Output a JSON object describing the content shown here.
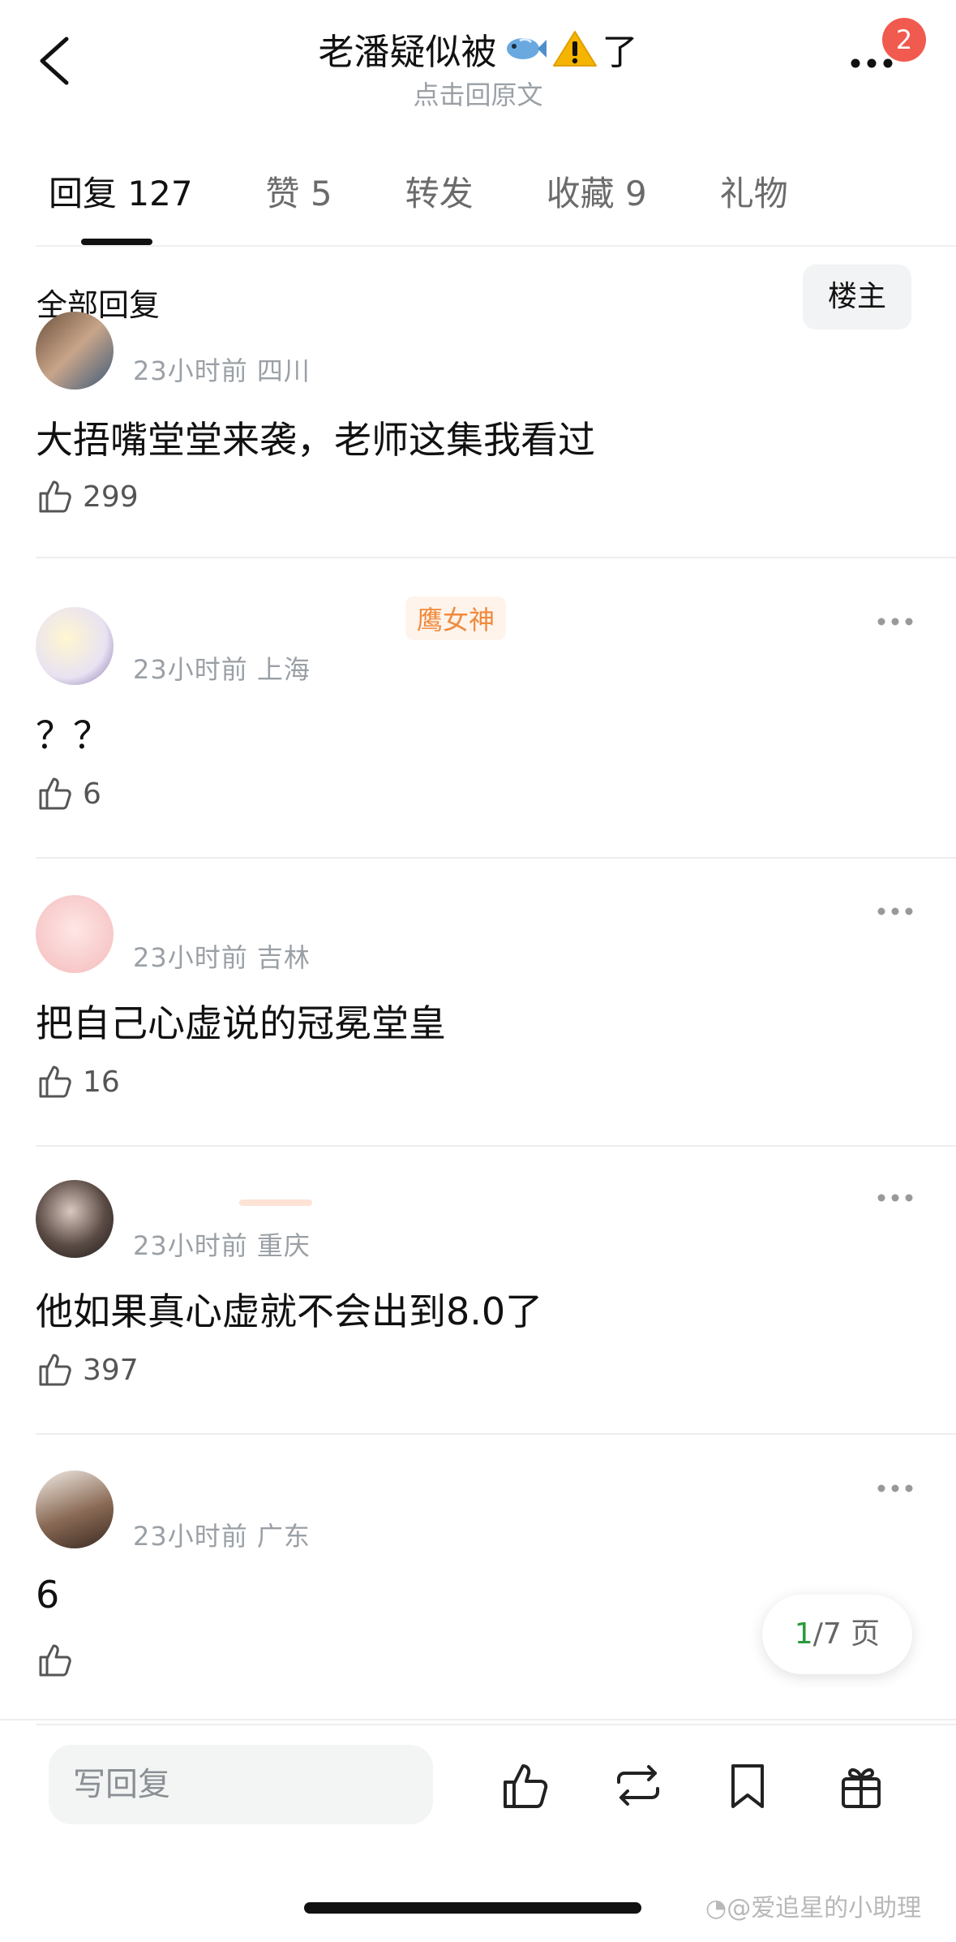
{
  "header": {
    "title_text_1": "老潘疑似被",
    "title_emoji_1": "fish-icon",
    "title_emoji_2": "warning-icon",
    "title_text_2": "了",
    "subtitle": "点击回原文",
    "notification_count": "2"
  },
  "tabs": [
    {
      "label": "回复",
      "count": "127",
      "active": true
    },
    {
      "label": "赞",
      "count": "5"
    },
    {
      "label": "转发",
      "count": ""
    },
    {
      "label": "收藏",
      "count": "9"
    },
    {
      "label": "礼物",
      "count": ""
    }
  ],
  "filter": {
    "label": "全部回复",
    "owner_button": "楼主"
  },
  "comments": [
    {
      "time": "23小时前",
      "location": "四川",
      "text": "大捂嘴堂堂来袭，老师这集我看过",
      "likes": "299"
    },
    {
      "time": "23小时前",
      "location": "上海",
      "text": "？？",
      "likes": "6",
      "badge": "鹰女神"
    },
    {
      "time": "23小时前",
      "location": "吉林",
      "text": "把自己心虚说的冠冕堂皇",
      "likes": "16"
    },
    {
      "time": "23小时前",
      "location": "重庆",
      "text": "他如果真心虚就不会出到8.0了",
      "likes": "397"
    },
    {
      "time": "23小时前",
      "location": "广东",
      "text": "6",
      "likes": ""
    }
  ],
  "pager": {
    "current": "1",
    "total": "/7 页"
  },
  "bottom_bar": {
    "reply_placeholder": "写回复"
  },
  "watermark": "@爱追星的小助理",
  "colors": {
    "badge": "#f05a4f",
    "tag_text": "#f08a3c",
    "pager_current": "#2a9a3a"
  }
}
